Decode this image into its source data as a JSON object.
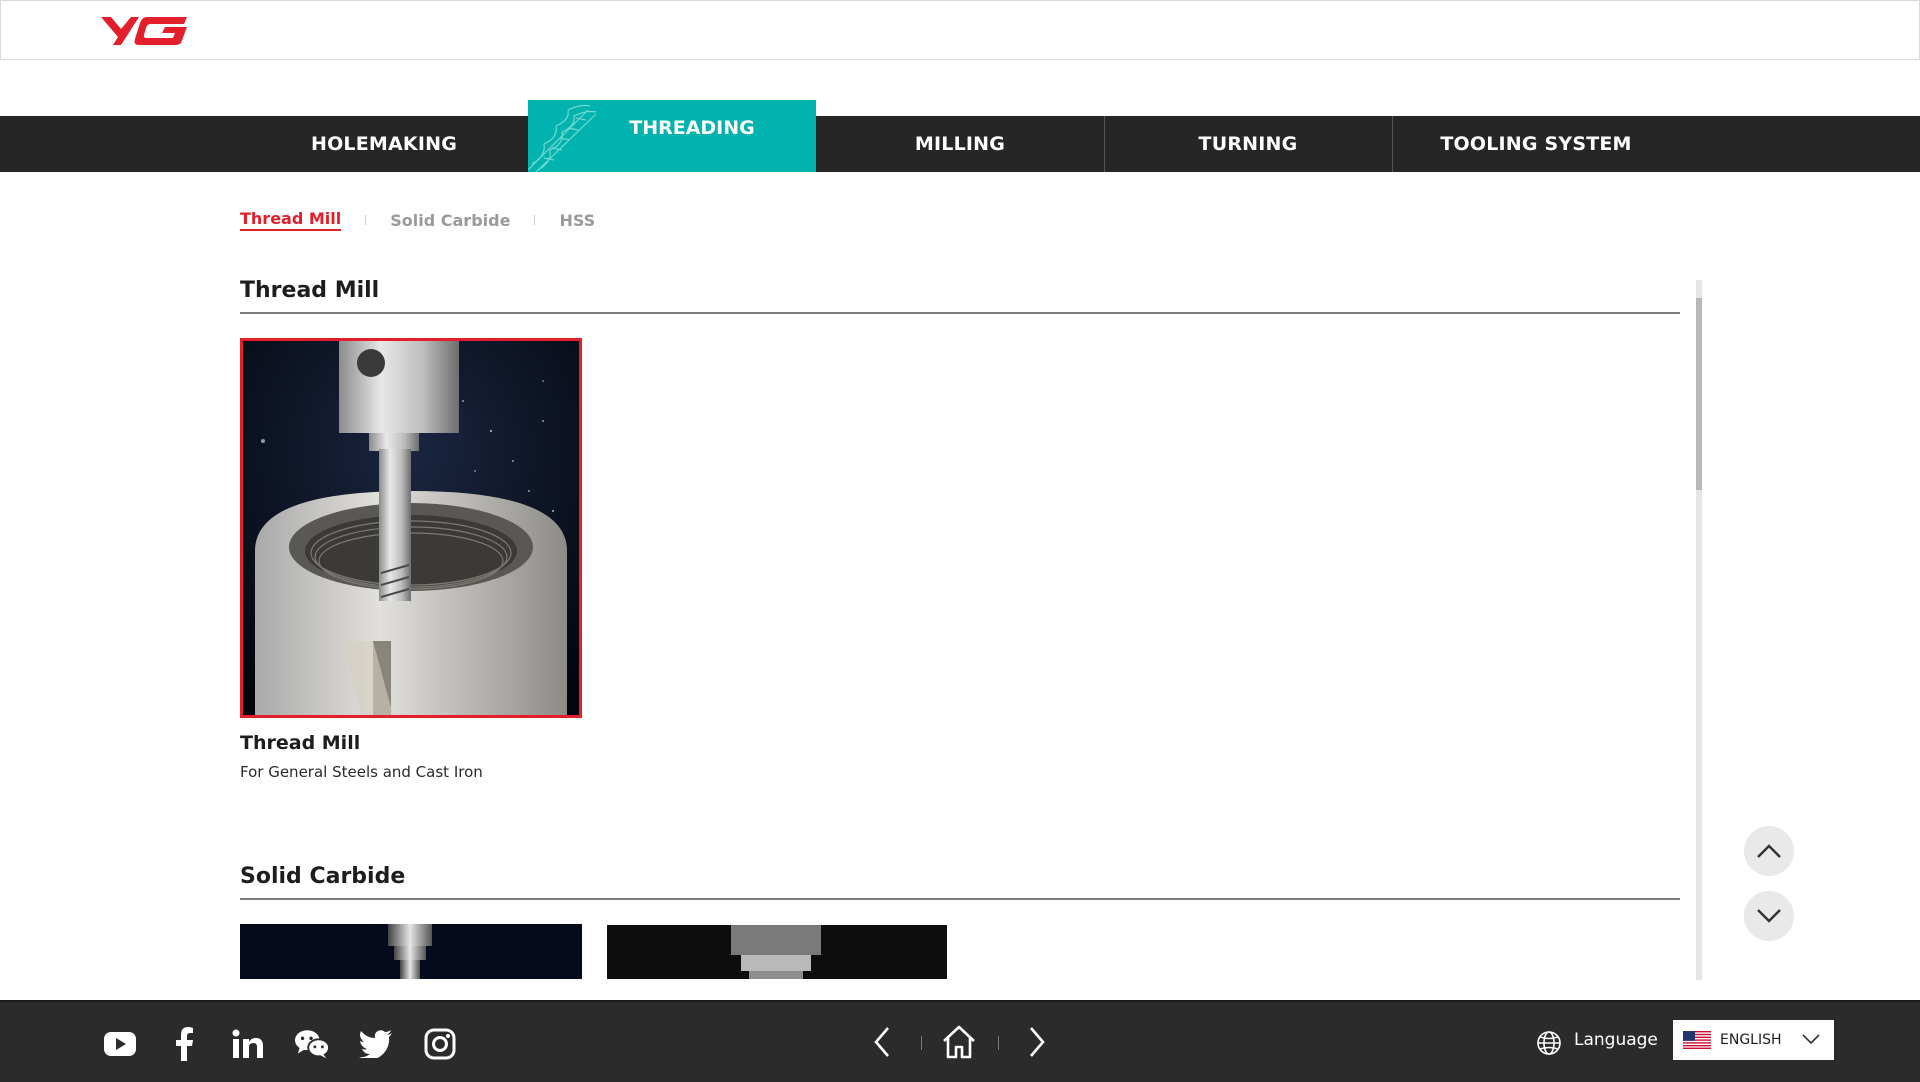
{
  "nav": {
    "items": [
      {
        "label": "HOLEMAKING"
      },
      {
        "label": "THREADING"
      },
      {
        "label": "MILLING"
      },
      {
        "label": "TURNING"
      },
      {
        "label": "TOOLING SYSTEM"
      }
    ],
    "active_index": 1
  },
  "subtabs": [
    {
      "label": "Thread Mill",
      "active": true
    },
    {
      "label": "Solid Carbide",
      "active": false
    },
    {
      "label": "HSS",
      "active": false
    }
  ],
  "sections": [
    {
      "title": "Thread Mill",
      "cards": [
        {
          "title": "Thread Mill",
          "subtitle": "For General Steels and Cast Iron",
          "selected": true
        }
      ]
    },
    {
      "title": "Solid Carbide",
      "cards": []
    }
  ],
  "footer": {
    "social": [
      "youtube-icon",
      "facebook-icon",
      "linkedin-icon",
      "wechat-icon",
      "twitter-icon",
      "instagram-icon"
    ],
    "language_label": "Language",
    "language_value": "ENGLISH"
  },
  "colors": {
    "accent_teal": "#00b3ae",
    "brand_red": "#e31f2b",
    "nav_bg": "#262626",
    "footer_bg": "#2b2b2b"
  }
}
